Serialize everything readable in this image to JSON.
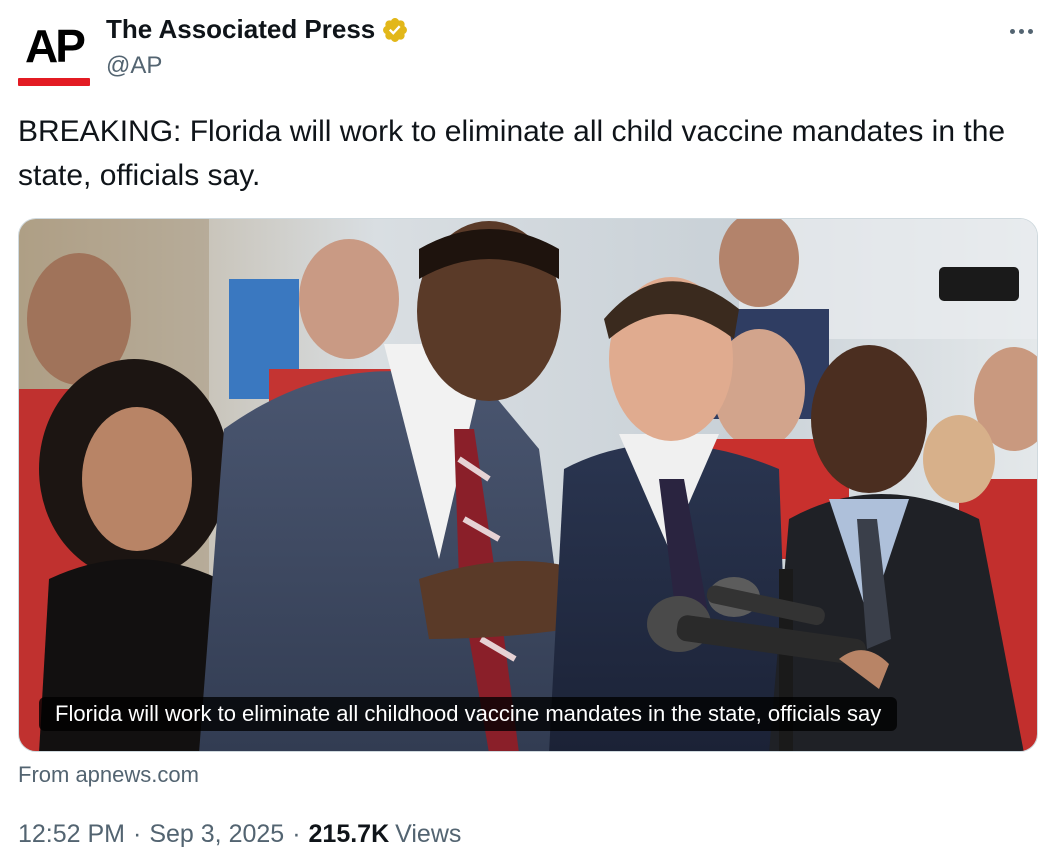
{
  "author": {
    "avatar_text": "AP",
    "display_name": "The Associated Press",
    "handle": "@AP",
    "verified": true,
    "verified_color": "#e2b719"
  },
  "tweet": {
    "text": "BREAKING: Florida will work to eliminate all child vaccine mandates in the state, officials say."
  },
  "media": {
    "caption": "Florida will work to eliminate all childhood vaccine mandates in the state, officials say",
    "source_label": "From apnews.com"
  },
  "meta": {
    "time": "12:52 PM",
    "separator": "·",
    "date": "Sep 3, 2025",
    "views_count": "215.7K",
    "views_label": "Views"
  },
  "icons": {
    "more": "more-icon",
    "verified": "verified-badge-icon"
  }
}
